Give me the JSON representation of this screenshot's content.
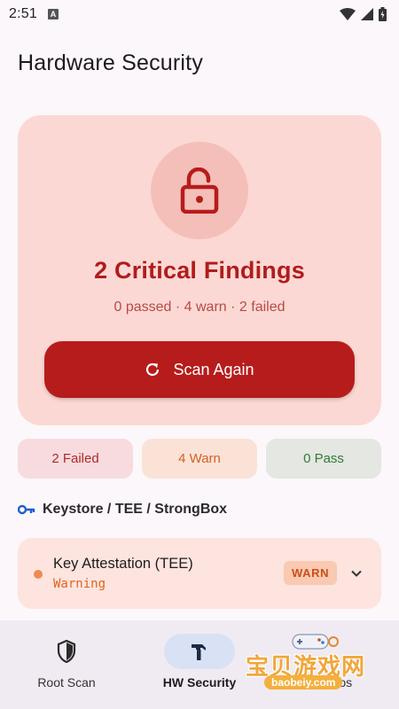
{
  "status_bar": {
    "time": "2:51"
  },
  "header": {
    "title": "Hardware Security"
  },
  "hero": {
    "title": "2 Critical Findings",
    "subtitle": "0 passed · 4 warn · 2 failed",
    "button_label": "Scan Again",
    "icon": "lock-open-icon"
  },
  "chips": [
    {
      "label": "2 Failed",
      "color": "#b02a2a"
    },
    {
      "label": "4 Warn",
      "color": "#d26223"
    },
    {
      "label": "0 Pass",
      "color": "#2f7d32"
    }
  ],
  "section": {
    "title": "Keystore / TEE / StrongBox",
    "icon": "key-icon"
  },
  "finding": {
    "title": "Key Attestation (TEE)",
    "status": "Warning",
    "badge": "WARN"
  },
  "bottom_nav": [
    {
      "label": "Root Scan",
      "icon": "shield-icon",
      "active": false
    },
    {
      "label": "HW Security",
      "icon": "hammer-icon",
      "active": true
    },
    {
      "label": "Demos",
      "icon": "",
      "active": false
    }
  ],
  "watermark": {
    "text": "宝贝游戏网",
    "url": "baobeiy.com"
  },
  "colors": {
    "accent": "#b71c1c",
    "hero_bg": "#fcd8d4",
    "nav_active": "#d8e2f4"
  }
}
